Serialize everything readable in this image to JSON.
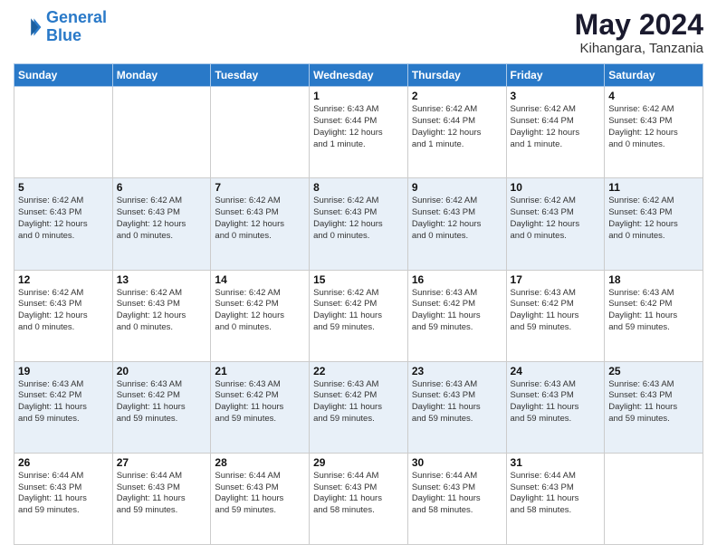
{
  "logo": {
    "line1": "General",
    "line2": "Blue"
  },
  "title": "May 2024",
  "location": "Kihangara, Tanzania",
  "days_header": [
    "Sunday",
    "Monday",
    "Tuesday",
    "Wednesday",
    "Thursday",
    "Friday",
    "Saturday"
  ],
  "weeks": [
    [
      {
        "day": "",
        "info": ""
      },
      {
        "day": "",
        "info": ""
      },
      {
        "day": "",
        "info": ""
      },
      {
        "day": "1",
        "info": "Sunrise: 6:43 AM\nSunset: 6:44 PM\nDaylight: 12 hours\nand 1 minute."
      },
      {
        "day": "2",
        "info": "Sunrise: 6:42 AM\nSunset: 6:44 PM\nDaylight: 12 hours\nand 1 minute."
      },
      {
        "day": "3",
        "info": "Sunrise: 6:42 AM\nSunset: 6:44 PM\nDaylight: 12 hours\nand 1 minute."
      },
      {
        "day": "4",
        "info": "Sunrise: 6:42 AM\nSunset: 6:43 PM\nDaylight: 12 hours\nand 0 minutes."
      }
    ],
    [
      {
        "day": "5",
        "info": "Sunrise: 6:42 AM\nSunset: 6:43 PM\nDaylight: 12 hours\nand 0 minutes."
      },
      {
        "day": "6",
        "info": "Sunrise: 6:42 AM\nSunset: 6:43 PM\nDaylight: 12 hours\nand 0 minutes."
      },
      {
        "day": "7",
        "info": "Sunrise: 6:42 AM\nSunset: 6:43 PM\nDaylight: 12 hours\nand 0 minutes."
      },
      {
        "day": "8",
        "info": "Sunrise: 6:42 AM\nSunset: 6:43 PM\nDaylight: 12 hours\nand 0 minutes."
      },
      {
        "day": "9",
        "info": "Sunrise: 6:42 AM\nSunset: 6:43 PM\nDaylight: 12 hours\nand 0 minutes."
      },
      {
        "day": "10",
        "info": "Sunrise: 6:42 AM\nSunset: 6:43 PM\nDaylight: 12 hours\nand 0 minutes."
      },
      {
        "day": "11",
        "info": "Sunrise: 6:42 AM\nSunset: 6:43 PM\nDaylight: 12 hours\nand 0 minutes."
      }
    ],
    [
      {
        "day": "12",
        "info": "Sunrise: 6:42 AM\nSunset: 6:43 PM\nDaylight: 12 hours\nand 0 minutes."
      },
      {
        "day": "13",
        "info": "Sunrise: 6:42 AM\nSunset: 6:43 PM\nDaylight: 12 hours\nand 0 minutes."
      },
      {
        "day": "14",
        "info": "Sunrise: 6:42 AM\nSunset: 6:42 PM\nDaylight: 12 hours\nand 0 minutes."
      },
      {
        "day": "15",
        "info": "Sunrise: 6:42 AM\nSunset: 6:42 PM\nDaylight: 11 hours\nand 59 minutes."
      },
      {
        "day": "16",
        "info": "Sunrise: 6:43 AM\nSunset: 6:42 PM\nDaylight: 11 hours\nand 59 minutes."
      },
      {
        "day": "17",
        "info": "Sunrise: 6:43 AM\nSunset: 6:42 PM\nDaylight: 11 hours\nand 59 minutes."
      },
      {
        "day": "18",
        "info": "Sunrise: 6:43 AM\nSunset: 6:42 PM\nDaylight: 11 hours\nand 59 minutes."
      }
    ],
    [
      {
        "day": "19",
        "info": "Sunrise: 6:43 AM\nSunset: 6:42 PM\nDaylight: 11 hours\nand 59 minutes."
      },
      {
        "day": "20",
        "info": "Sunrise: 6:43 AM\nSunset: 6:42 PM\nDaylight: 11 hours\nand 59 minutes."
      },
      {
        "day": "21",
        "info": "Sunrise: 6:43 AM\nSunset: 6:42 PM\nDaylight: 11 hours\nand 59 minutes."
      },
      {
        "day": "22",
        "info": "Sunrise: 6:43 AM\nSunset: 6:42 PM\nDaylight: 11 hours\nand 59 minutes."
      },
      {
        "day": "23",
        "info": "Sunrise: 6:43 AM\nSunset: 6:43 PM\nDaylight: 11 hours\nand 59 minutes."
      },
      {
        "day": "24",
        "info": "Sunrise: 6:43 AM\nSunset: 6:43 PM\nDaylight: 11 hours\nand 59 minutes."
      },
      {
        "day": "25",
        "info": "Sunrise: 6:43 AM\nSunset: 6:43 PM\nDaylight: 11 hours\nand 59 minutes."
      }
    ],
    [
      {
        "day": "26",
        "info": "Sunrise: 6:44 AM\nSunset: 6:43 PM\nDaylight: 11 hours\nand 59 minutes."
      },
      {
        "day": "27",
        "info": "Sunrise: 6:44 AM\nSunset: 6:43 PM\nDaylight: 11 hours\nand 59 minutes."
      },
      {
        "day": "28",
        "info": "Sunrise: 6:44 AM\nSunset: 6:43 PM\nDaylight: 11 hours\nand 59 minutes."
      },
      {
        "day": "29",
        "info": "Sunrise: 6:44 AM\nSunset: 6:43 PM\nDaylight: 11 hours\nand 58 minutes."
      },
      {
        "day": "30",
        "info": "Sunrise: 6:44 AM\nSunset: 6:43 PM\nDaylight: 11 hours\nand 58 minutes."
      },
      {
        "day": "31",
        "info": "Sunrise: 6:44 AM\nSunset: 6:43 PM\nDaylight: 11 hours\nand 58 minutes."
      },
      {
        "day": "",
        "info": ""
      }
    ]
  ]
}
